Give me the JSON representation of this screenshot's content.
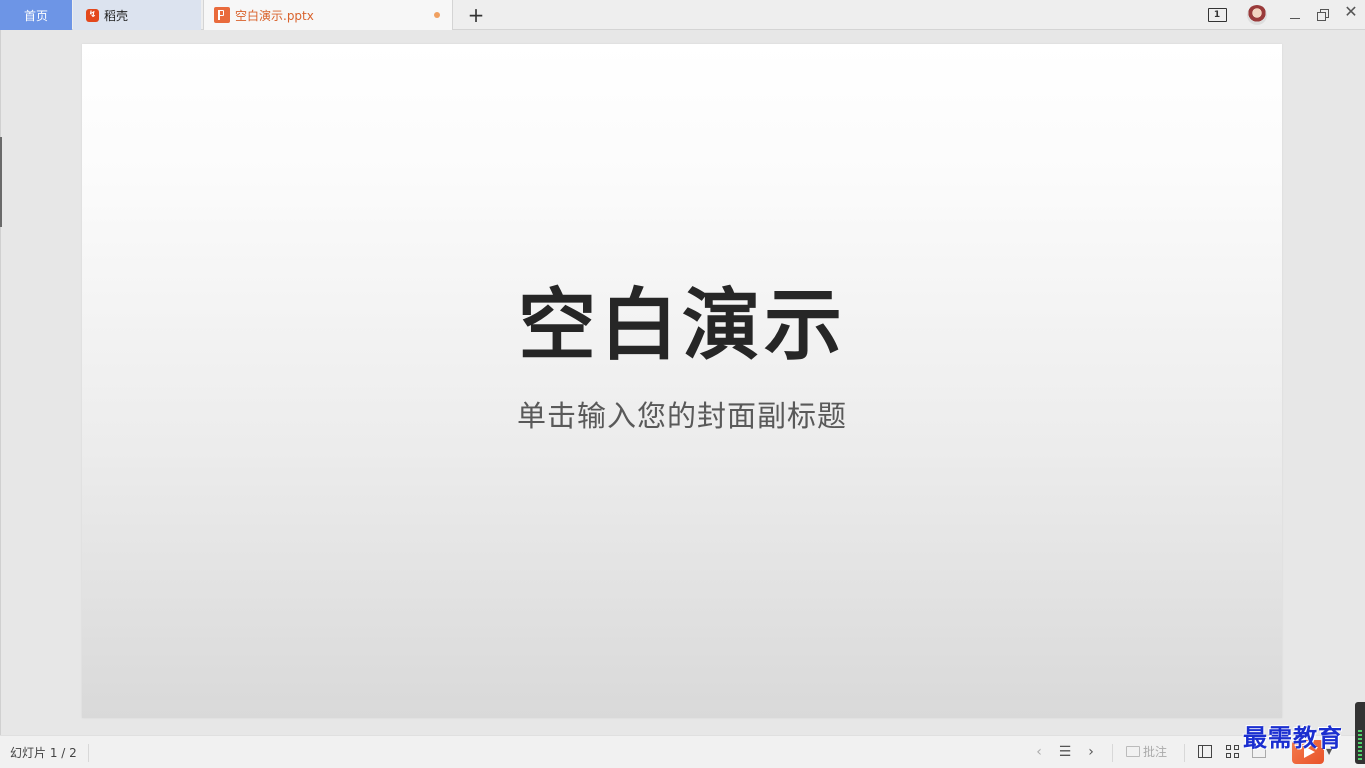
{
  "titlebar": {
    "tabs": [
      {
        "label": "首页",
        "active": false
      },
      {
        "label": "稻壳",
        "active": false
      },
      {
        "label": "空白演示.pptx",
        "active": true,
        "modified": true
      }
    ],
    "new_tab_glyph": "+",
    "window_count": "1",
    "icons": {
      "new_tab": "plus-icon",
      "window_count": "window-count-icon",
      "avatar": "user-avatar",
      "minimize": "minimize-icon",
      "restore": "restore-icon",
      "close": "close-icon"
    }
  },
  "slide": {
    "title": "空白演示",
    "subtitle": "单击输入您的封面副标题"
  },
  "statusbar": {
    "slide_counter": "幻灯片 1 / 2",
    "comment_label": "批注",
    "icons": {
      "prev": "chevron-left-icon",
      "outline": "list-icon",
      "next": "chevron-right-icon",
      "normal_view": "normal-view-icon",
      "sorter_view": "grid-view-icon",
      "reading_view": "reading-view-icon",
      "play": "play-icon"
    }
  },
  "watermark": "最需教育",
  "colors": {
    "home_tab": "#6d95e6",
    "doc_accent": "#d9622c",
    "play_button": "#e8532a",
    "watermark": "#1b2fd0"
  }
}
